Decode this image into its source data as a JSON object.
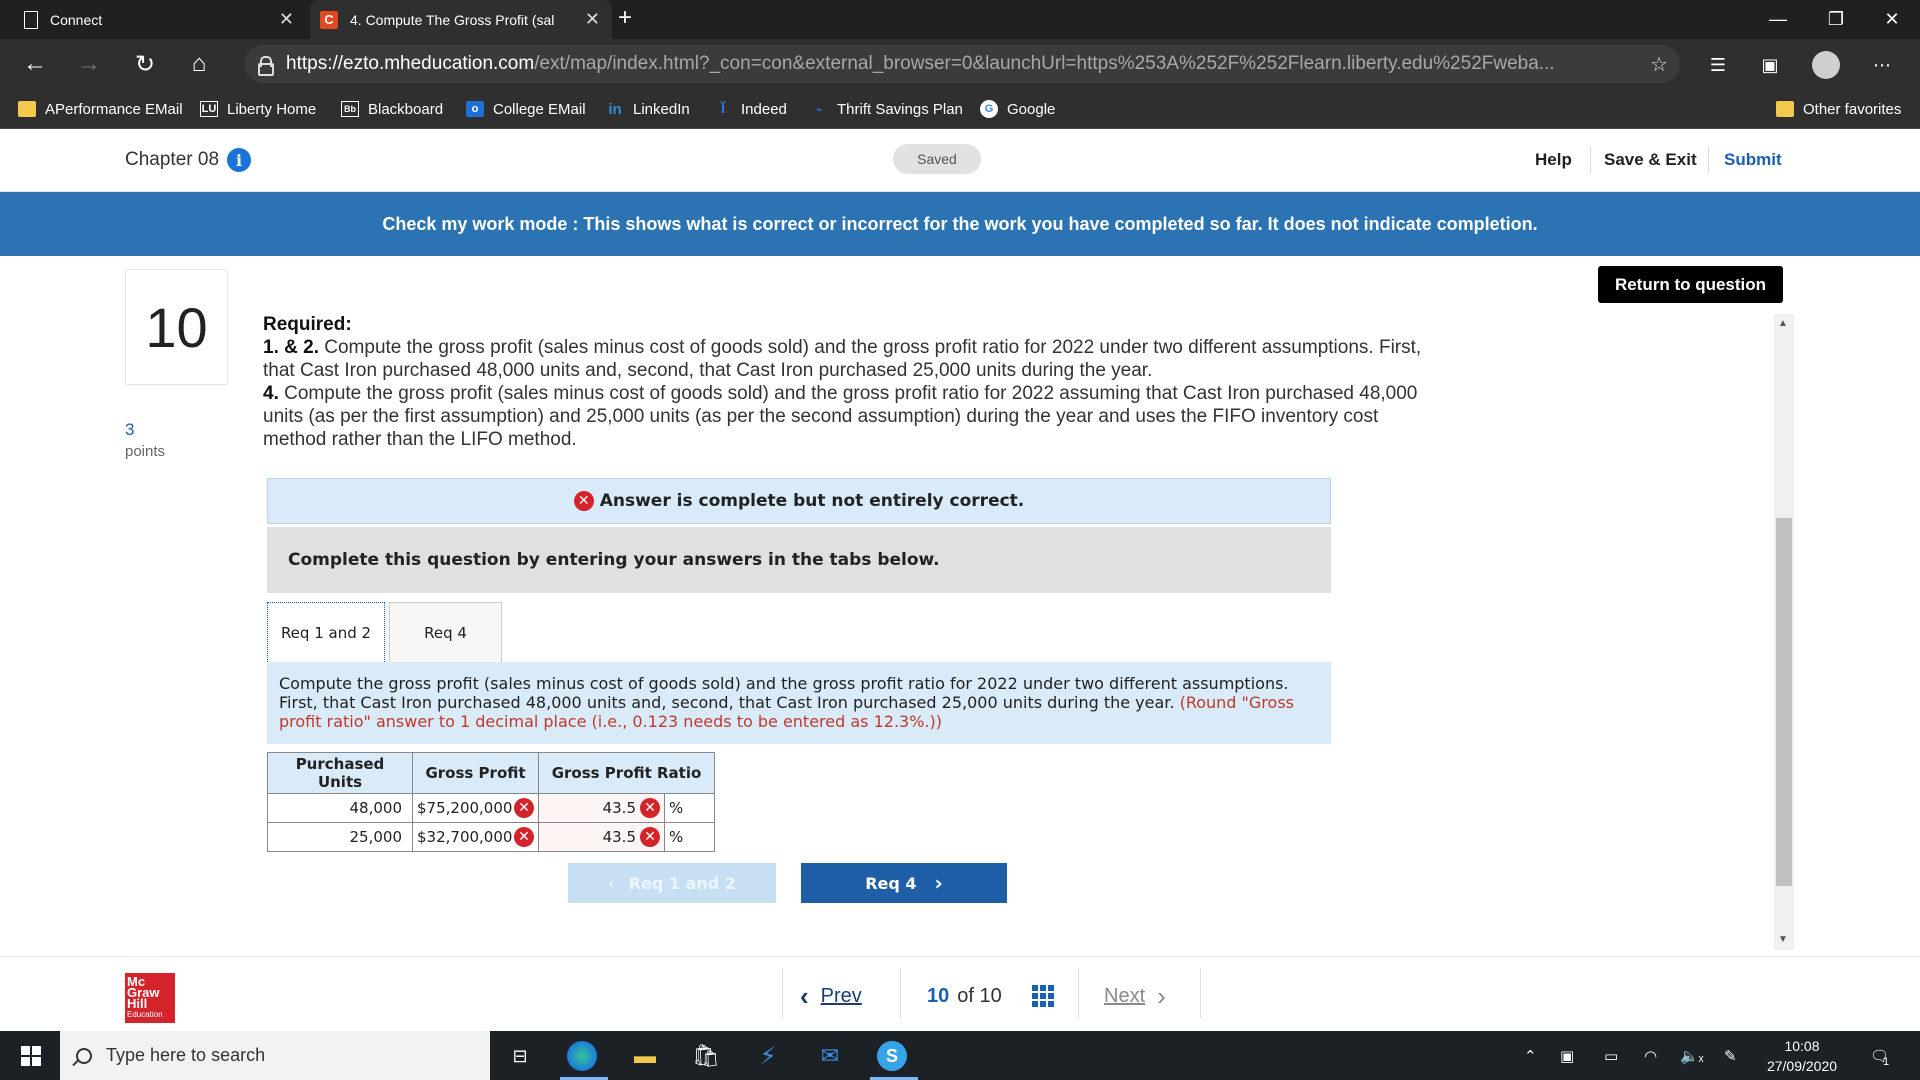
{
  "browser": {
    "tabs": [
      {
        "title": "Connect"
      },
      {
        "title": "4. Compute The Gross Profit (sal"
      }
    ],
    "url_host": "https://ezto.mheducation.com",
    "url_path": "/ext/map/index.html?_con=con&external_browser=0&launchUrl=https%253A%252F%252Flearn.liberty.edu%252Fweba...",
    "favorites": [
      {
        "label": "APerformance EMail",
        "icon": "folder-icon"
      },
      {
        "label": "Liberty Home",
        "icon": "lu-icon"
      },
      {
        "label": "Blackboard",
        "icon": "bb-icon"
      },
      {
        "label": "College EMail",
        "icon": "outlook-icon"
      },
      {
        "label": "LinkedIn",
        "icon": "linkedin-icon"
      },
      {
        "label": "Indeed",
        "icon": "indeed-icon"
      },
      {
        "label": "Thrift Savings Plan",
        "icon": "tsp-icon"
      },
      {
        "label": "Google",
        "icon": "google-icon"
      }
    ],
    "other_favorites": "Other favorites"
  },
  "header": {
    "chapter": "Chapter 08",
    "saved": "Saved",
    "help": "Help",
    "save_exit": "Save & Exit",
    "submit": "Submit"
  },
  "banner": "Check my work mode : This shows what is correct or incorrect for the work you have completed so far. It does not indicate completion.",
  "question": {
    "number": "10",
    "points": "3",
    "points_label": "points",
    "return_label": "Return to question",
    "required_heading": "Required:",
    "req_12_label": "1. & 2.",
    "req_12_text": "Compute the gross profit (sales minus cost of goods sold) and the gross profit ratio for 2022 under two different assumptions. First, that Cast Iron purchased 48,000 units and, second, that Cast Iron purchased 25,000 units during the year.",
    "req_4_label": "4.",
    "req_4_text": "Compute the gross profit (sales minus cost of goods sold) and the gross profit ratio for 2022 assuming that Cast Iron purchased 48,000 units (as per the first assumption) and 25,000 units (as per the second assumption) during the year and uses the FIFO inventory cost method rather than the LIFO method."
  },
  "answer_status": "Answer is complete but not entirely correct.",
  "complete_prompt": "Complete this question by entering your answers in the tabs below.",
  "tabs": [
    "Req 1 and 2",
    "Req 4"
  ],
  "instructions": {
    "text": "Compute the gross profit (sales minus cost of goods sold) and the gross profit ratio for 2022 under two different assumptions. First, that Cast Iron purchased 48,000 units and, second, that Cast Iron purchased 25,000 units during the year.",
    "note": "(Round \"Gross profit ratio\" answer to 1 decimal place (i.e., 0.123 needs to be entered as 12.3%.))"
  },
  "table": {
    "headers": [
      "Purchased Units",
      "Gross Profit",
      "Gross Profit Ratio"
    ],
    "rows": [
      {
        "units": "48,000",
        "gross_profit": "$75,200,000",
        "ratio": "43.5",
        "pct": "%"
      },
      {
        "units": "25,000",
        "gross_profit": "$32,700,000",
        "ratio": "43.5",
        "pct": "%"
      }
    ]
  },
  "nav_buttons": {
    "prev": "Req 1 and 2",
    "next": "Req 4"
  },
  "pager": {
    "prev": "Prev",
    "current": "10",
    "of": "of 10",
    "next": "Next"
  },
  "logo": [
    "Mc",
    "Graw",
    "Hill",
    "Education"
  ],
  "taskbar": {
    "search_placeholder": "Type here to search",
    "time": "10:08",
    "date": "27/09/2020",
    "notification_count": "1"
  }
}
